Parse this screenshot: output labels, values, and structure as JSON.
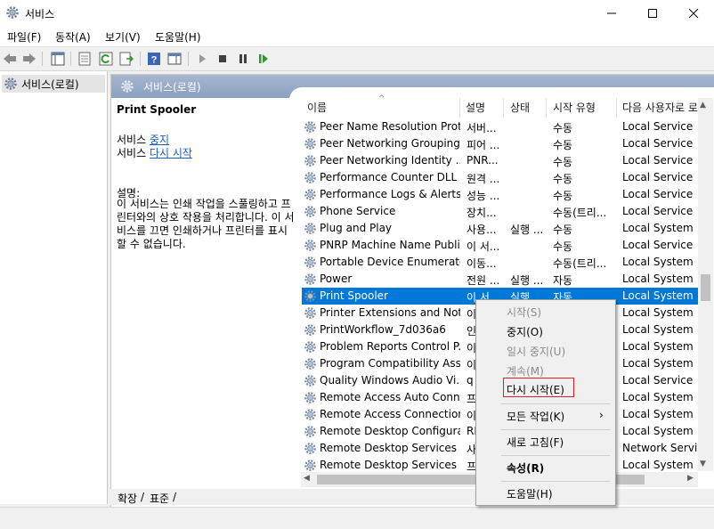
{
  "window": {
    "title": "서비스",
    "minimize_icon": "minimize-icon",
    "maximize_icon": "maximize-icon",
    "close_icon": "close-icon"
  },
  "menu": [
    "파일(F)",
    "동작(A)",
    "보기(V)",
    "도움말(H)"
  ],
  "tree": {
    "root_label": "서비스(로컬)"
  },
  "pane": {
    "header_title": "서비스(로컬)"
  },
  "details": {
    "service_title": "Print Spooler",
    "stop_prefix": "서비스",
    "stop_link": "중지",
    "restart_prefix": "서비스",
    "restart_link": "다시 시작",
    "desc_label": "설명:",
    "desc_text": "이 서비스는 인쇄 작업을 스풀링하고 프린터와의 상호 작용을 처리합니다. 이 서비스를 끄면 인쇄하거나 프린터를 표시할 수 없습니다."
  },
  "columns": [
    "이름",
    "설명",
    "상태",
    "시작 유형",
    "다음 사용자로 로"
  ],
  "services": [
    {
      "name": "Peer Name Resolution Prot...",
      "desc": "서버...",
      "status": "",
      "startup": "수동",
      "logon": "Local Service"
    },
    {
      "name": "Peer Networking Grouping",
      "desc": "피어 ...",
      "status": "",
      "startup": "수동",
      "logon": "Local Service"
    },
    {
      "name": "Peer Networking Identity ...",
      "desc": "PNR...",
      "status": "",
      "startup": "수동",
      "logon": "Local Service"
    },
    {
      "name": "Performance Counter DLL ...",
      "desc": "원격 ...",
      "status": "",
      "startup": "수동",
      "logon": "Local Service"
    },
    {
      "name": "Performance Logs & Alerts",
      "desc": "성능 ...",
      "status": "",
      "startup": "수동",
      "logon": "Local Service"
    },
    {
      "name": "Phone Service",
      "desc": "장치...",
      "status": "",
      "startup": "수동(트리...",
      "logon": "Local Service"
    },
    {
      "name": "Plug and Play",
      "desc": "사용...",
      "status": "실행 ...",
      "startup": "수동",
      "logon": "Local System"
    },
    {
      "name": "PNRP Machine Name Publi...",
      "desc": "이 서...",
      "status": "",
      "startup": "수동",
      "logon": "Local Service"
    },
    {
      "name": "Portable Device Enumerato...",
      "desc": "이동...",
      "status": "",
      "startup": "수동(트리...",
      "logon": "Local System"
    },
    {
      "name": "Power",
      "desc": "전원 ...",
      "status": "실행 ...",
      "startup": "자동",
      "logon": "Local System"
    },
    {
      "name": "Print Spooler",
      "desc": "이 서...",
      "status": "실행 ...",
      "startup": "자동",
      "logon": "Local System"
    },
    {
      "name": "Printer Extensions and Noti...",
      "desc": "이",
      "status": "",
      "startup": "",
      "logon": "Local System"
    },
    {
      "name": "PrintWorkflow_7d036a6",
      "desc": "인",
      "status": "",
      "startup": "",
      "logon": "Local System"
    },
    {
      "name": "Problem Reports Control P...",
      "desc": "이",
      "status": "",
      "startup": "",
      "logon": "Local System"
    },
    {
      "name": "Program Compatibility Assi...",
      "desc": "이",
      "status": "",
      "startup": "",
      "logon": "Local System"
    },
    {
      "name": "Quality Windows Audio Vi...",
      "desc": "q",
      "status": "",
      "startup": "",
      "logon": "Local Service"
    },
    {
      "name": "Remote Access Auto Conn...",
      "desc": "프",
      "status": "",
      "startup": "",
      "logon": "Local System"
    },
    {
      "name": "Remote Access Connection...",
      "desc": "이",
      "status": "",
      "startup": "",
      "logon": "Local System"
    },
    {
      "name": "Remote Desktop Configura...",
      "desc": "RI",
      "status": "",
      "startup": "",
      "logon": "Local System"
    },
    {
      "name": "Remote Desktop Services",
      "desc": "사",
      "status": "",
      "startup": "",
      "logon": "Network Service"
    },
    {
      "name": "Remote Desktop Services ...",
      "desc": "프",
      "status": "",
      "startup": "",
      "logon": "Local System"
    }
  ],
  "selected_service": "Print Spooler",
  "context_menu": {
    "items": [
      {
        "label": "시작(S)",
        "disabled": true
      },
      {
        "label": "중지(O)",
        "disabled": false
      },
      {
        "label": "일시 중지(U)",
        "disabled": true
      },
      {
        "label": "계속(M)",
        "disabled": true
      },
      {
        "label": "다시 시작(E)",
        "disabled": false,
        "highlighted": true
      },
      {
        "label": "모든 작업(K)",
        "disabled": false,
        "submenu": true
      },
      {
        "label": "새로 고침(F)",
        "disabled": false
      },
      {
        "label": "속성(R)",
        "disabled": false,
        "bold": true
      },
      {
        "label": "도움말(H)",
        "disabled": false
      }
    ],
    "submenu_arrow": "›"
  },
  "tabs": [
    "확장",
    "표준"
  ],
  "colors": {
    "selection": "#0078d7",
    "header_gradient": "#8aa1c0",
    "link": "#1a5dbb",
    "highlight_box": "#e02020"
  }
}
